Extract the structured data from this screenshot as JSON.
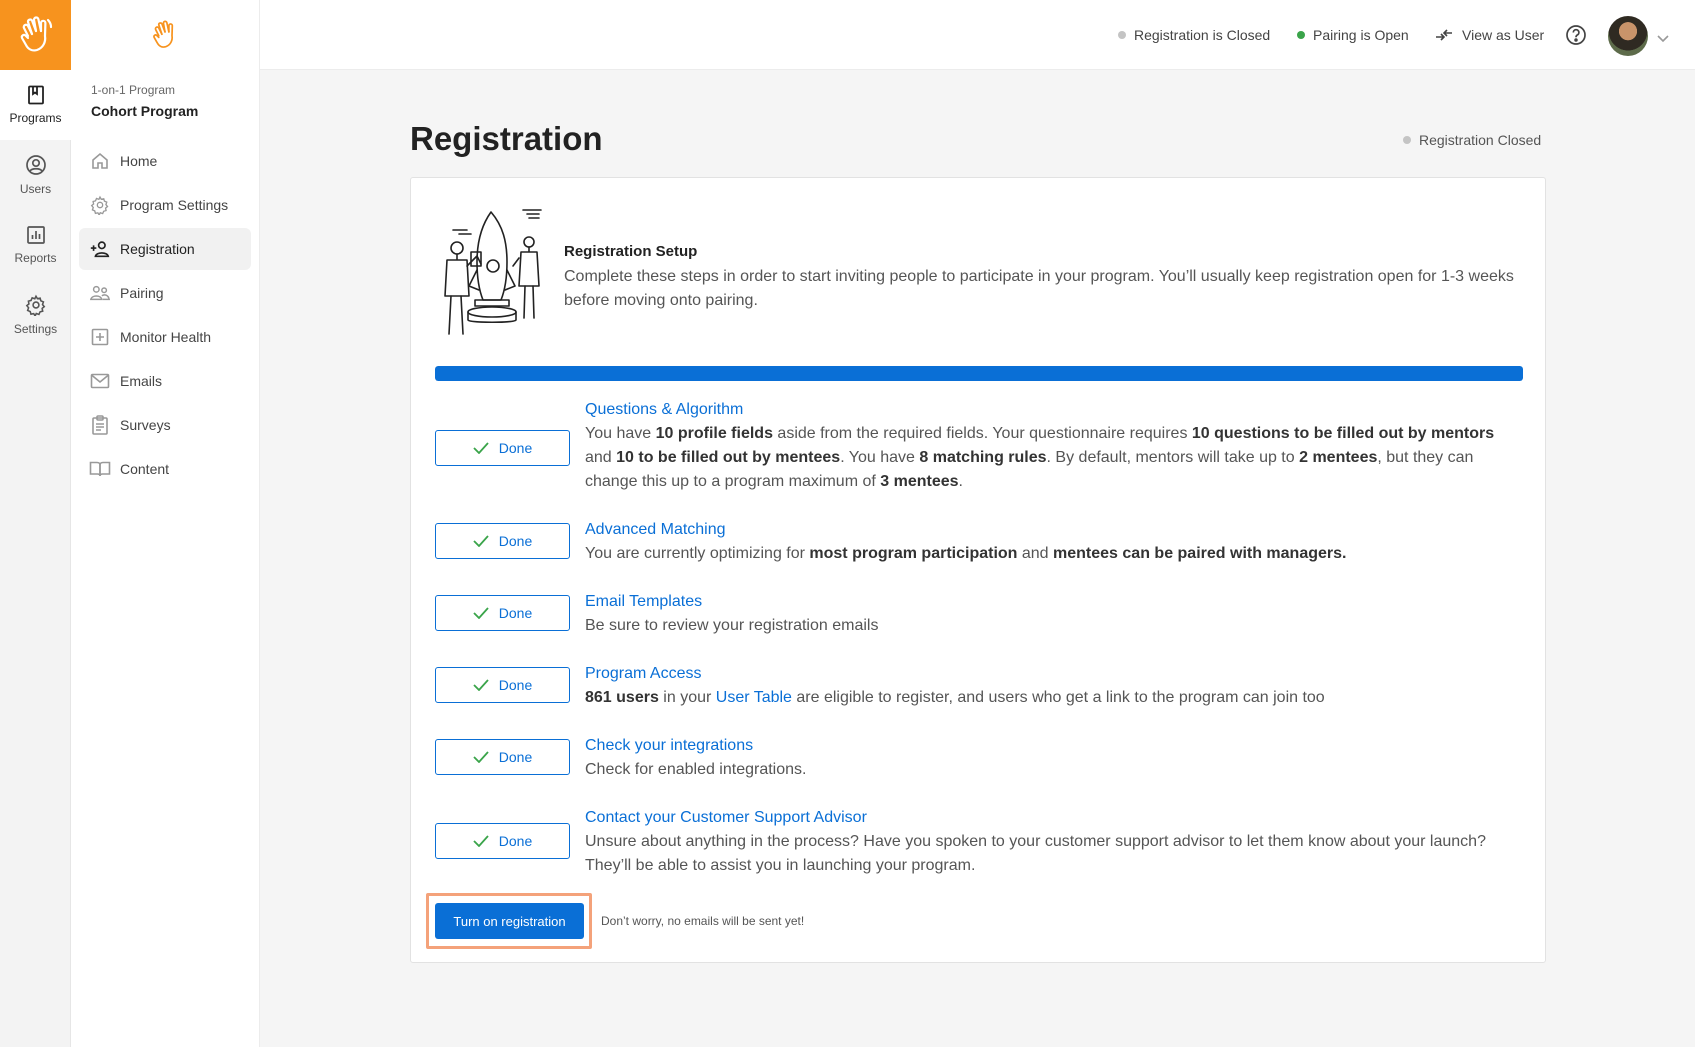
{
  "rail": {
    "items": [
      {
        "label": "Programs",
        "icon": "book-icon",
        "active": true
      },
      {
        "label": "Users",
        "icon": "user-circle-icon"
      },
      {
        "label": "Reports",
        "icon": "bar-chart-icon"
      },
      {
        "label": "Settings",
        "icon": "gear-icon"
      }
    ]
  },
  "sidebar": {
    "program_type": "1-on-1 Program",
    "program_name": "Cohort Program",
    "items": [
      {
        "label": "Home",
        "icon": "home-icon"
      },
      {
        "label": "Program Settings",
        "icon": "gear-icon"
      },
      {
        "label": "Registration",
        "icon": "add-user-icon",
        "active": true
      },
      {
        "label": "Pairing",
        "icon": "users-icon"
      },
      {
        "label": "Monitor Health",
        "icon": "plus-box-icon"
      },
      {
        "label": "Emails",
        "icon": "mail-icon"
      },
      {
        "label": "Surveys",
        "icon": "clipboard-icon"
      },
      {
        "label": "Content",
        "icon": "book-open-icon"
      }
    ]
  },
  "topbar": {
    "registration_status": "Registration is Closed",
    "pairing_status": "Pairing is Open",
    "view_as_user": "View as User"
  },
  "page": {
    "title": "Registration",
    "status": "Registration Closed"
  },
  "setup": {
    "title": "Registration Setup",
    "description": "Complete these steps in order to start inviting people to participate in your program. You’ll usually keep registration open for 1-3 weeks before moving onto pairing.",
    "progress": 1.0,
    "done_label": "Done",
    "steps": [
      {
        "title": "Questions & Algorithm"
      },
      {
        "title": "Advanced Matching"
      },
      {
        "title": "Email Templates",
        "text": "Be sure to review your registration emails"
      },
      {
        "title": "Program Access"
      },
      {
        "title": "Check your integrations",
        "text": "Check for enabled integrations."
      },
      {
        "title": "Contact your Customer Support Advisor",
        "text": "Unsure about anything in the process? Have you spoken to your customer support advisor to let them know about your launch? They’ll be able to assist you in launching your program."
      }
    ],
    "q": {
      "t1": "You have ",
      "b1": "10 profile fields",
      "t2": " aside from the required fields. Your questionnaire requires ",
      "b2": "10 questions to be filled out by mentors",
      "t3": " and ",
      "b3": "10 to be filled out by mentees",
      "t4": ". You have ",
      "b4": "8 matching rules",
      "t5": ". By default, mentors will take up to ",
      "b5": "2 mentees",
      "t6": ", but they can change this up to a program maximum of ",
      "b6": "3 mentees",
      "t7": "."
    },
    "am": {
      "t1": "You are currently optimizing for ",
      "b1": "most program participation",
      "t2": " and ",
      "b2": "mentees can be paired with managers."
    },
    "pa": {
      "b1": "861 users",
      "t1": " in your ",
      "link": "User Table",
      "t2": " are eligible to register, and users who get a link to the program can join too"
    },
    "cta_label": "Turn on registration",
    "cta_note": "Don’t worry, no emails will be sent yet!"
  },
  "colors": {
    "brand_orange": "#f7931e",
    "primary_blue": "#0a6fd6",
    "status_closed": "#c4c4c4",
    "status_open": "#3aa44a",
    "highlight": "#f4a27a"
  }
}
